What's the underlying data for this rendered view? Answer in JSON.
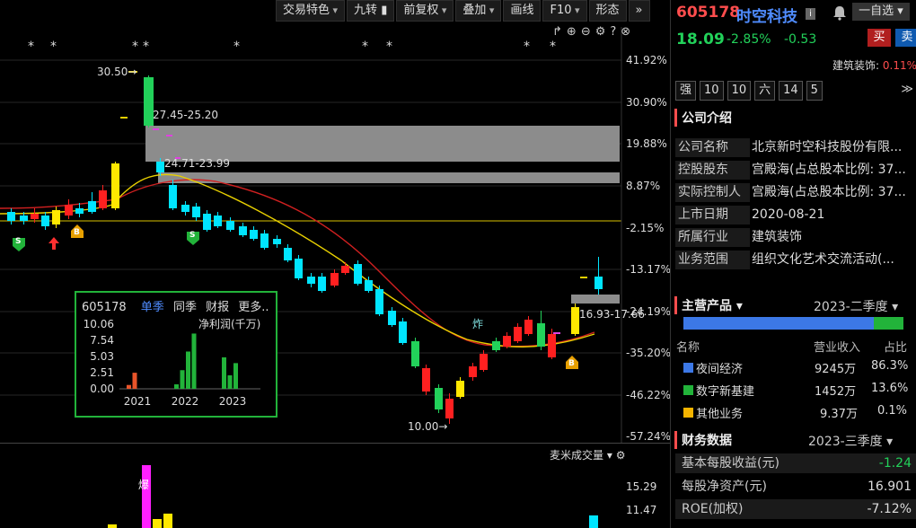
{
  "toolbar": {
    "items": [
      "交易特色",
      "九转",
      "前复权",
      "叠加",
      "画线",
      "F10",
      "形态"
    ],
    "more": "»"
  },
  "chart_icons": [
    "share-icon",
    "zoom-in-icon",
    "zoom-out-icon",
    "settings-icon",
    "help-icon",
    "close-icon"
  ],
  "price_axis": [
    "41.92%",
    "30.90%",
    "19.88%",
    "8.87%",
    "-2.15%",
    "-13.17%",
    "-24.19%",
    "-35.20%",
    "-46.22%",
    "-57.24%"
  ],
  "annotations": {
    "high_label": "30.50",
    "zone1": "27.45-25.20",
    "zone2": "24.71-23.99",
    "zone3": "16.93-17.66",
    "low_label": "10.00",
    "zha": "炸",
    "bao": "爆",
    "s1": "S",
    "s2": "S",
    "b1": "B",
    "b2": "B"
  },
  "profit_box": {
    "code": "605178",
    "tabs": [
      "单季",
      "同季",
      "财报",
      "更多.."
    ],
    "title": "净利润(千万)",
    "chart_data": {
      "type": "bar",
      "title": "净利润(千万)",
      "ylabels": [
        "10.06",
        "7.54",
        "5.03",
        "2.51",
        "0.00"
      ],
      "ylim": [
        0,
        10.06
      ],
      "groups": [
        "2021",
        "2022",
        "2023"
      ],
      "series": [
        {
          "values": [
            0.6,
            2.5,
            0,
            0,
            0.7,
            2.9,
            5.8,
            8.6,
            4.9,
            2.1,
            4.0
          ]
        }
      ],
      "colors": [
        "#e8542a",
        "#e8542a",
        "#22b33a",
        "#22b33a",
        "#22b33a",
        "#22b33a",
        "#22b33a",
        "#22b33a",
        "#22b33a",
        "#22b33a",
        "#22b33a"
      ]
    }
  },
  "volume": {
    "title": "麦米成交量",
    "axis": [
      "15.29",
      "11.47"
    ]
  },
  "right": {
    "code": "605178",
    "name": "时空科技",
    "info": "i",
    "watch": "一自选",
    "price": "18.09",
    "pct": "-2.85%",
    "chg": "-0.53",
    "buy": "买",
    "sell": "卖",
    "industry_name": "建筑装饰:",
    "industry_pct": "0.11%",
    "tags": [
      "强",
      "10",
      "10",
      "六",
      "14",
      "5"
    ],
    "company": {
      "title": "公司介绍",
      "rows": [
        {
          "label": "公司名称",
          "value": "北京新时空科技股份有限..."
        },
        {
          "label": "控股股东",
          "value": "宫殿海(占总股本比例: 37..."
        },
        {
          "label": "实际控制人",
          "value": "宫殿海(占总股本比例: 37..."
        },
        {
          "label": "上市日期",
          "value": "2020-08-21"
        },
        {
          "label": "所属行业",
          "value": "建筑装饰"
        },
        {
          "label": "业务范围",
          "value": "组织文化艺术交流活动(..."
        }
      ]
    },
    "products": {
      "title": "主营产品",
      "period": "2023-二季度",
      "headers": [
        "名称",
        "营业收入",
        "占比"
      ],
      "rows": [
        {
          "name": "夜间经济",
          "revenue": "9245万",
          "share": "86.3%",
          "color": "#3c78e6"
        },
        {
          "name": "数字新基建",
          "revenue": "1452万",
          "share": "13.6%",
          "color": "#22b33a"
        },
        {
          "name": "其他业务",
          "revenue": "9.37万",
          "share": "0.1%",
          "color": "#f5b400"
        }
      ]
    },
    "finance": {
      "title": "财务数据",
      "period": "2023-三季度",
      "rows": [
        {
          "label": "基本每股收益(元)",
          "value": "-1.24",
          "color": "#22d15a"
        },
        {
          "label": "每股净资产(元)",
          "value": "16.901",
          "color": "#ddd"
        },
        {
          "label": "ROE(加权)",
          "value": "-7.12%",
          "color": "#ddd"
        }
      ]
    }
  }
}
